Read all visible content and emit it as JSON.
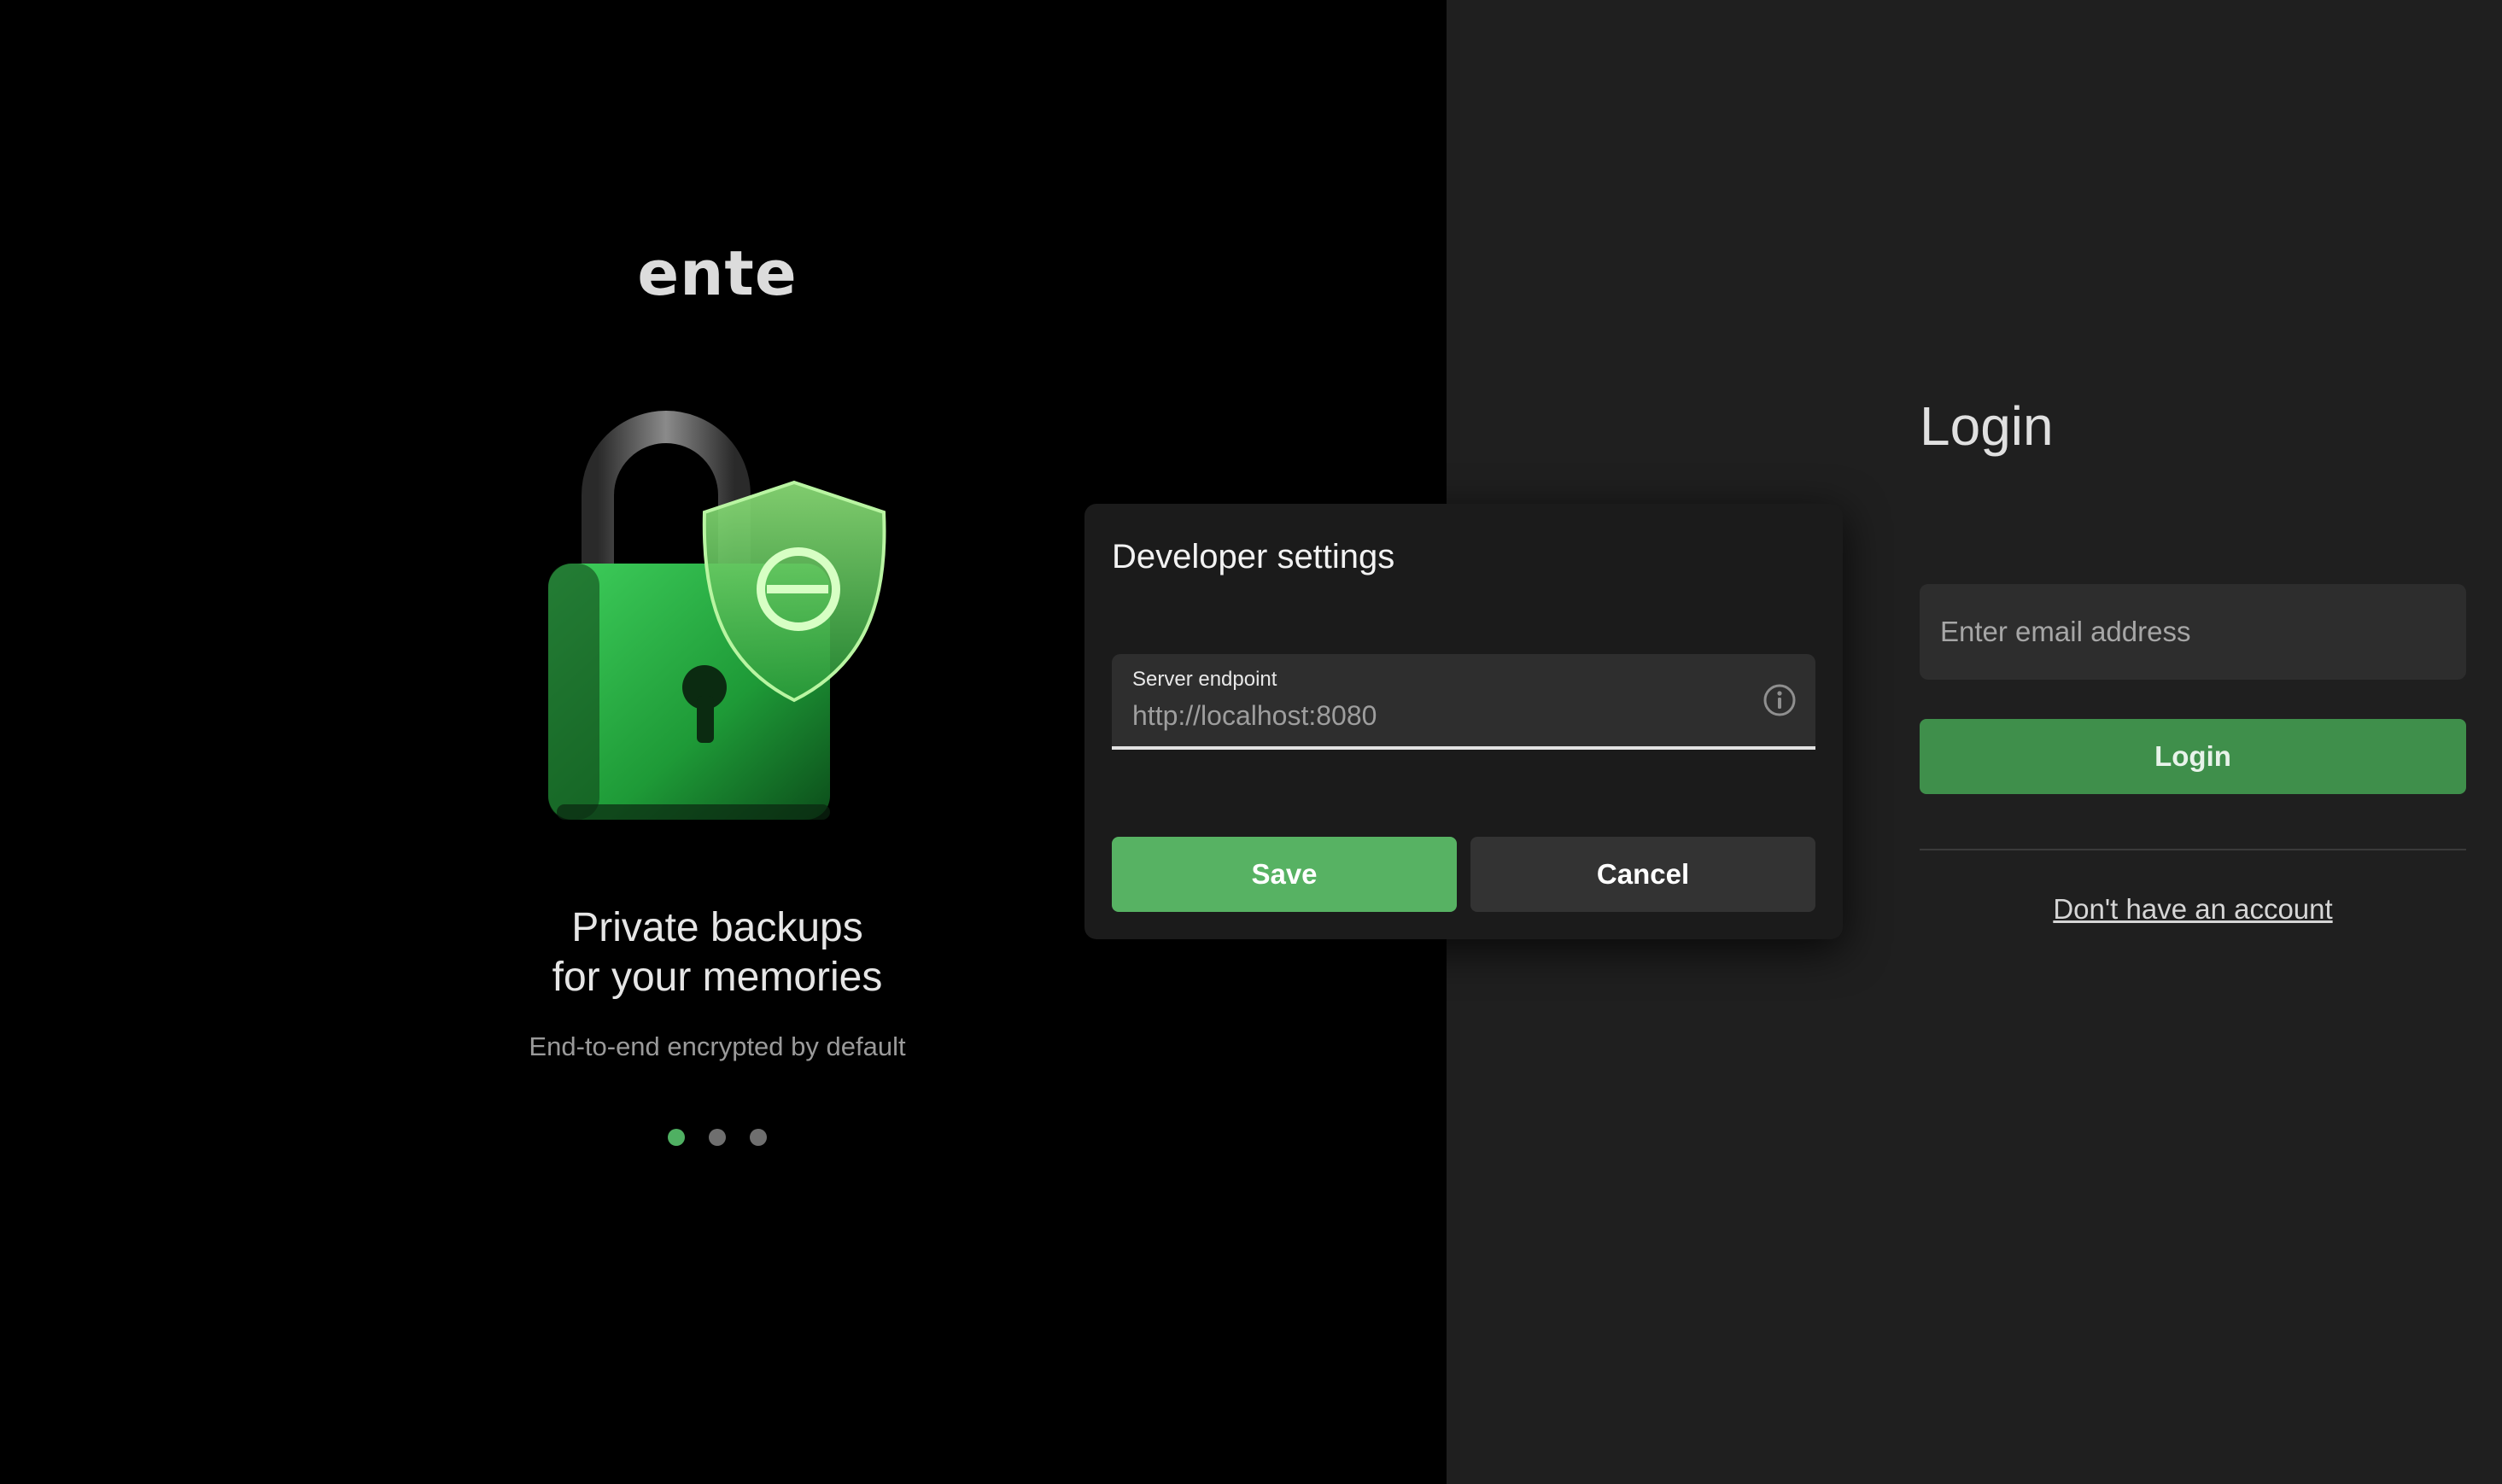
{
  "brand": {
    "logo_text": "ente"
  },
  "carousel": {
    "headline_line1": "Private backups",
    "headline_line2": "for your memories",
    "subtitle": "End-to-end encrypted by default",
    "active_index": 0,
    "total_slides": 3,
    "illustration_icon": "padlock-shield-icon"
  },
  "login": {
    "title": "Login",
    "email_placeholder": "Enter email address",
    "login_button": "Login",
    "signup_link": "Don't have an account"
  },
  "dialog": {
    "title": "Developer settings",
    "field_label": "Server endpoint",
    "field_value": "http://localhost:8080",
    "info_icon": "info-icon",
    "save_button": "Save",
    "cancel_button": "Cancel"
  },
  "colors": {
    "accent_green": "#57b263",
    "login_button_green": "#3f8f4b",
    "left_background": "#000000",
    "right_background": "#1f1f1f",
    "dialog_background": "#1b1b1b"
  }
}
